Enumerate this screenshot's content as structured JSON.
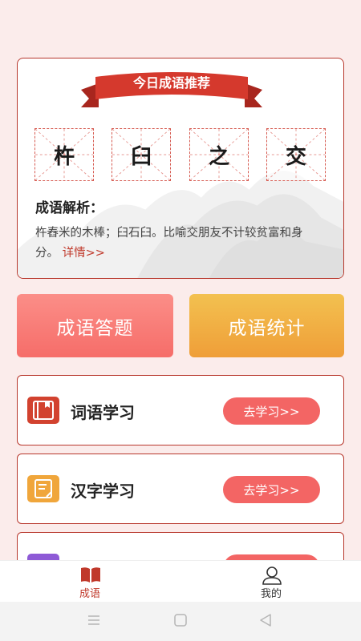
{
  "recommend": {
    "banner_title": "今日成语推荐",
    "characters": [
      "杵",
      "臼",
      "之",
      "交"
    ],
    "analysis_title": "成语解析：",
    "analysis_text": "杵舂米的木棒；臼石臼。比喻交朋友不计较贫富和身分。",
    "detail_link": "详情>>"
  },
  "actions": {
    "answer_label": "成语答题",
    "stats_label": "成语统计"
  },
  "study": [
    {
      "label": "词语学习",
      "button": "去学习>>",
      "icon": "book-icon"
    },
    {
      "label": "汉字学习",
      "button": "去学习>>",
      "icon": "document-edit-icon"
    },
    {
      "label": "",
      "button": "",
      "icon": "purple-app-icon"
    }
  ],
  "tabs": [
    {
      "label": "成语",
      "icon": "open-book-icon",
      "active": true
    },
    {
      "label": "我的",
      "icon": "user-icon",
      "active": false
    }
  ],
  "colors": {
    "accent": "#b8372c",
    "active_tab": "#c0392b",
    "study_button": "#f36564",
    "answer_button": "#f77370",
    "stats_button": "#f0a63b"
  }
}
